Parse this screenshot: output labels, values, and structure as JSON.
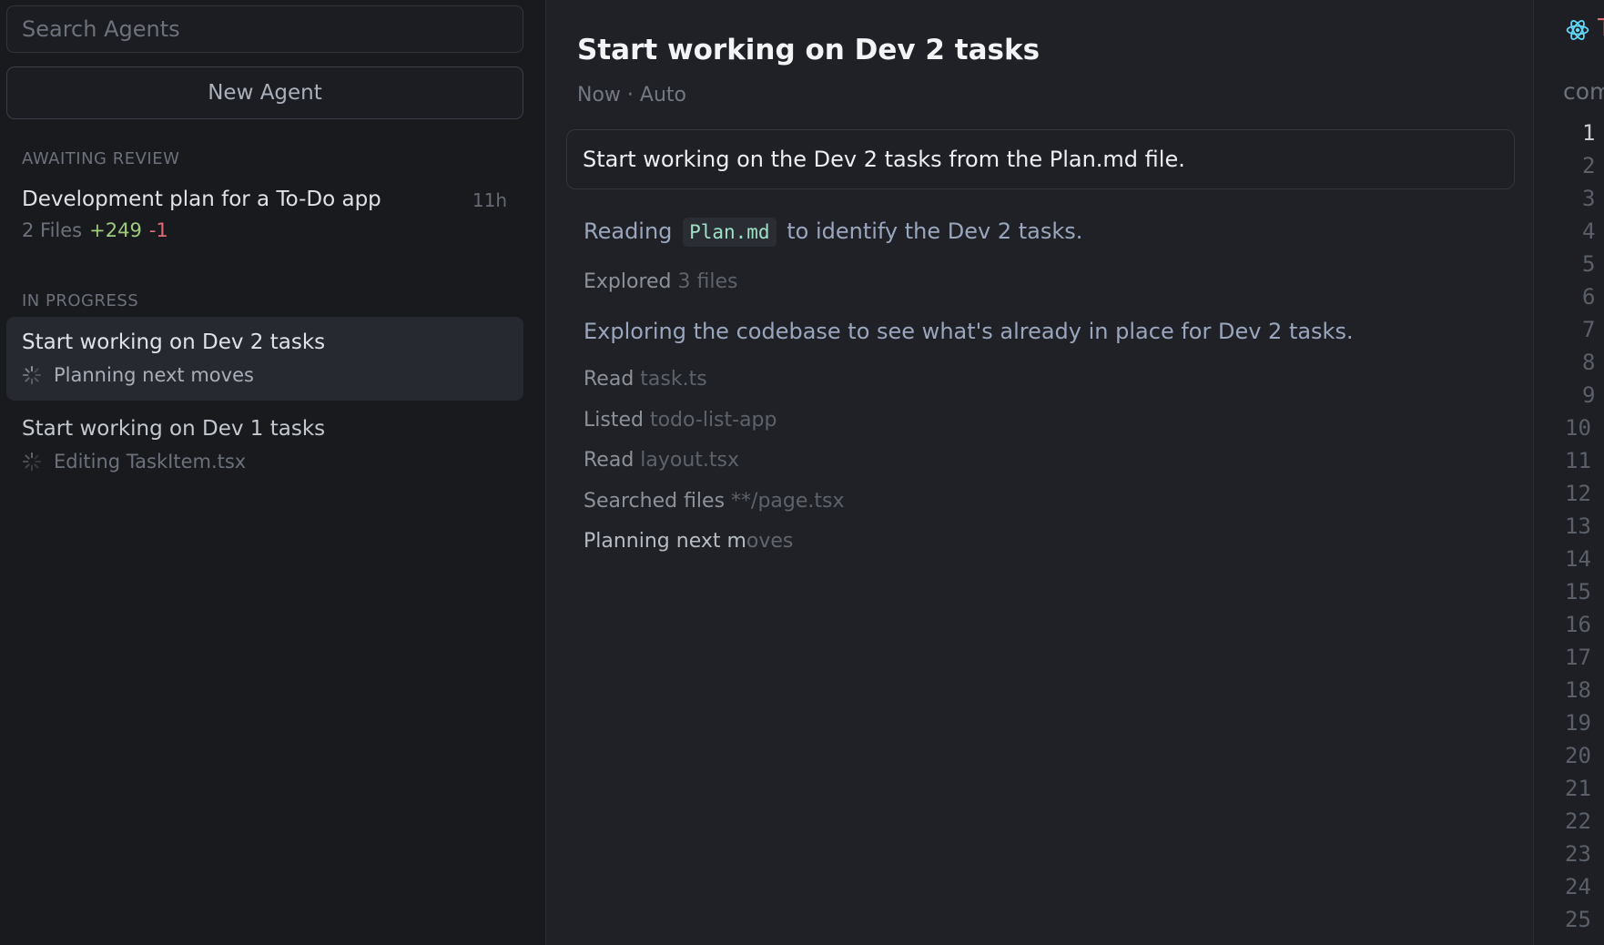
{
  "sidebar": {
    "search_placeholder": "Search Agents",
    "new_agent_label": "New Agent",
    "sections": {
      "awaiting_review": "AWAITING REVIEW",
      "in_progress": "IN PROGRESS"
    },
    "awaiting": [
      {
        "title": "Development plan for a To-Do app",
        "time": "11h",
        "files": "2 Files",
        "additions": "+249",
        "deletions": "-1"
      }
    ],
    "in_progress": [
      {
        "title": "Start working on Dev 2 tasks",
        "status": "Planning next moves",
        "active": true
      },
      {
        "title": "Start working on Dev 1 tasks",
        "status": "Editing TaskItem.tsx",
        "active": false
      }
    ]
  },
  "main": {
    "title": "Start working on Dev 2 tasks",
    "meta": "Now · Auto",
    "prompt": "Start working on the Dev 2 tasks from the Plan.md file.",
    "steps": {
      "reading_prefix": "Reading",
      "reading_file": "Plan.md",
      "reading_suffix": "to identify the Dev 2 tasks.",
      "explored_verb": "Explored",
      "explored_arg": "3 files",
      "exploring": "Exploring the codebase to see what's already in place for Dev 2 tasks.",
      "tools": [
        {
          "verb": "Read",
          "arg": "task.ts"
        },
        {
          "verb": "Listed",
          "arg": "todo-list-app"
        },
        {
          "verb": "Read",
          "arg": "layout.tsx"
        },
        {
          "verb": "Searched files",
          "arg": "**/page.tsx"
        }
      ],
      "planning_bright": "Planning next m",
      "planning_fade": "oves"
    }
  },
  "editor": {
    "tab_letter": "T",
    "breadcrumb": "com",
    "line_numbers": [
      "1",
      "2",
      "3",
      "4",
      "5",
      "6",
      "7",
      "8",
      "9",
      "10",
      "11",
      "12",
      "13",
      "14",
      "15",
      "16",
      "17",
      "18",
      "19",
      "20",
      "21",
      "22",
      "23",
      "24",
      "25"
    ]
  },
  "colors": {
    "additions": "#9fcb7c",
    "deletions": "#e06c75",
    "code_chip_text": "#9fe0c6",
    "react_icon": "#61dafb"
  }
}
